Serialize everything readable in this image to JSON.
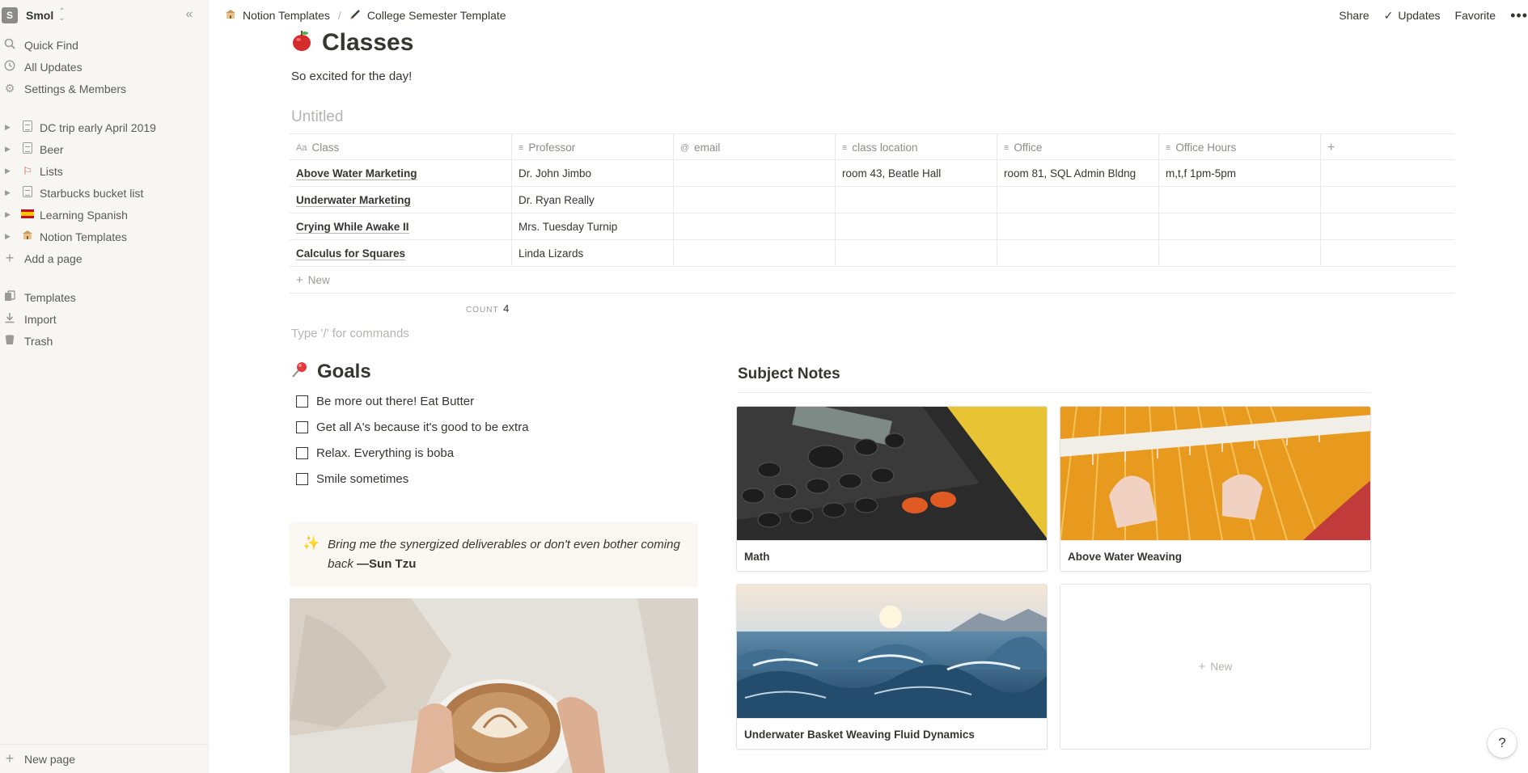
{
  "sidebar": {
    "workspace_initial": "S",
    "workspace_name": "Smol",
    "nav": [
      {
        "icon": "search-icon",
        "label": "Quick Find"
      },
      {
        "icon": "clock-icon",
        "label": "All Updates"
      },
      {
        "icon": "gear-icon",
        "label": "Settings & Members"
      }
    ],
    "pages": [
      {
        "icon": "document-icon",
        "label": "DC trip early April 2019"
      },
      {
        "icon": "document-icon",
        "label": "Beer"
      },
      {
        "icon": "lists-emoji-icon",
        "label": "Lists"
      },
      {
        "icon": "document-icon",
        "label": "Starbucks bucket list"
      },
      {
        "icon": "spain-flag-icon",
        "label": "Learning Spanish"
      },
      {
        "icon": "school-emoji-icon",
        "label": "Notion Templates"
      }
    ],
    "add_page": "Add a page",
    "footer_nav": [
      {
        "icon": "templates-icon",
        "label": "Templates"
      },
      {
        "icon": "import-icon",
        "label": "Import"
      },
      {
        "icon": "trash-icon",
        "label": "Trash"
      }
    ],
    "new_page": "New page"
  },
  "breadcrumb": {
    "items": [
      {
        "icon": "school-emoji-icon",
        "label": "Notion Templates"
      },
      {
        "icon": "pen-emoji-icon",
        "label": "College Semester Template"
      }
    ],
    "separator": "/"
  },
  "topbar": {
    "share": "Share",
    "updates": "Updates",
    "favorite": "Favorite"
  },
  "page": {
    "emoji": "🍎",
    "title": "Classes",
    "intro": "So excited for the day!",
    "db_title": "Untitled"
  },
  "table": {
    "columns": [
      {
        "icon": "Aa",
        "label": "Class"
      },
      {
        "icon": "≡",
        "label": "Professor"
      },
      {
        "icon": "@",
        "label": "email"
      },
      {
        "icon": "≡",
        "label": "class location"
      },
      {
        "icon": "≡",
        "label": "Office"
      },
      {
        "icon": "≡",
        "label": "Office Hours"
      }
    ],
    "rows": [
      [
        "Above Water Marketing",
        "Dr. John Jimbo",
        "",
        "room 43, Beatle Hall",
        "room 81, SQL Admin Bldng",
        "m,t,f 1pm-5pm"
      ],
      [
        "Underwater Marketing",
        "Dr. Ryan Really",
        "",
        "",
        "",
        ""
      ],
      [
        "Crying While Awake II",
        "Mrs. Tuesday Turnip",
        "",
        "",
        "",
        ""
      ],
      [
        "Calculus for Squares",
        "Linda Lizards",
        "",
        "",
        "",
        ""
      ]
    ],
    "new_label": "New",
    "count_label": "COUNT",
    "count_value": "4"
  },
  "command_placeholder": "Type '/' for commands",
  "goals": {
    "emoji": "📌",
    "title": "Goals",
    "items": [
      "Be more out there! Eat Butter",
      "Get all A's because it's good to be extra",
      "Relax. Everything is boba",
      "Smile sometimes"
    ]
  },
  "callout": {
    "quote": "Bring me the synergized deliverables or don't even bother coming back",
    "author": "—Sun Tzu"
  },
  "subject_notes": {
    "title": "Subject Notes",
    "cards": [
      {
        "label": "Math"
      },
      {
        "label": "Above Water Weaving"
      },
      {
        "label": "Underwater Basket Weaving Fluid Dynamics"
      }
    ],
    "new_label": "New"
  },
  "help": "?",
  "colors": {
    "sidebar_bg": "#f7f6f3",
    "text": "#37352f",
    "muted": "#9b9a97",
    "callout_bg": "#fbf8f3"
  }
}
